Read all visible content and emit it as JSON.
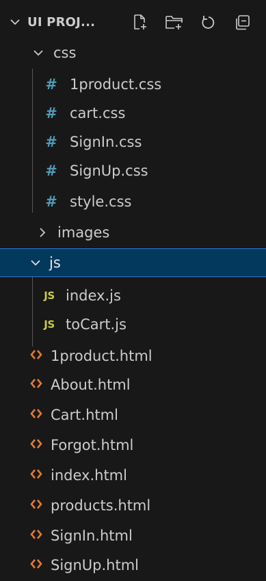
{
  "explorer": {
    "title": "UI PROJ...",
    "actions": [
      "new-file-icon",
      "new-folder-icon",
      "refresh-icon",
      "collapse-all-icon"
    ]
  },
  "colors": {
    "background": "#181818",
    "selected_background": "#04395e",
    "selected_border": "#2b79d4",
    "css_icon": "#519aba",
    "js_icon": "#cbcb41",
    "html_icon": "#e37933"
  },
  "tree": {
    "css_folder": {
      "label": "css",
      "expanded": true
    },
    "css_files": [
      {
        "label": "1product.css"
      },
      {
        "label": "cart.css"
      },
      {
        "label": "SignIn.css"
      },
      {
        "label": "SignUp.css"
      },
      {
        "label": "style.css"
      }
    ],
    "images_folder": {
      "label": "images",
      "expanded": false
    },
    "js_folder": {
      "label": "js",
      "expanded": true,
      "selected": true
    },
    "js_files": [
      {
        "label": "index.js"
      },
      {
        "label": "toCart.js"
      }
    ],
    "html_files": [
      {
        "label": "1product.html"
      },
      {
        "label": "About.html"
      },
      {
        "label": "Cart.html"
      },
      {
        "label": "Forgot.html"
      },
      {
        "label": "index.html"
      },
      {
        "label": "products.html"
      },
      {
        "label": "SignIn.html"
      },
      {
        "label": "SignUp.html"
      }
    ],
    "css_icon_glyph": "#",
    "js_icon_glyph": "JS"
  }
}
